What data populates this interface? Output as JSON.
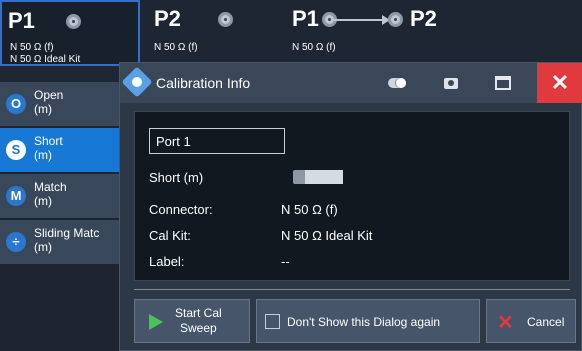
{
  "ports": {
    "p1": {
      "title": "P1",
      "line1": "N 50 Ω (f)",
      "line2": "N 50 Ω Ideal Kit"
    },
    "p2": {
      "title": "P2",
      "line1": "N 50 Ω (f)"
    },
    "p1p2": {
      "title_left": "P1",
      "title_right": "P2",
      "line1": "N 50 Ω (f)"
    }
  },
  "standards": [
    {
      "badge": "O",
      "label": "Open\n(m)"
    },
    {
      "badge": "S",
      "label": "Short\n(m)",
      "active": true
    },
    {
      "badge": "M",
      "label": "Match\n(m)"
    },
    {
      "badge": "÷",
      "label": "Sliding Matc\n(m)"
    }
  ],
  "dialog": {
    "title": "Calibration Info",
    "port_field": "Port 1",
    "standard_name": "Short (m)",
    "rows": [
      {
        "label": "Connector:",
        "value": "N 50 Ω (f)"
      },
      {
        "label": "Cal Kit:",
        "value": "N 50 Ω Ideal Kit"
      },
      {
        "label": "Label:",
        "value": "--"
      }
    ],
    "buttons": {
      "start": "Start Cal\nSweep",
      "dont_show": "Don't Show this Dialog again",
      "cancel": "Cancel"
    }
  },
  "colors": {
    "accent": "#1878d6",
    "close": "#e0393e",
    "play": "#47c35a"
  }
}
